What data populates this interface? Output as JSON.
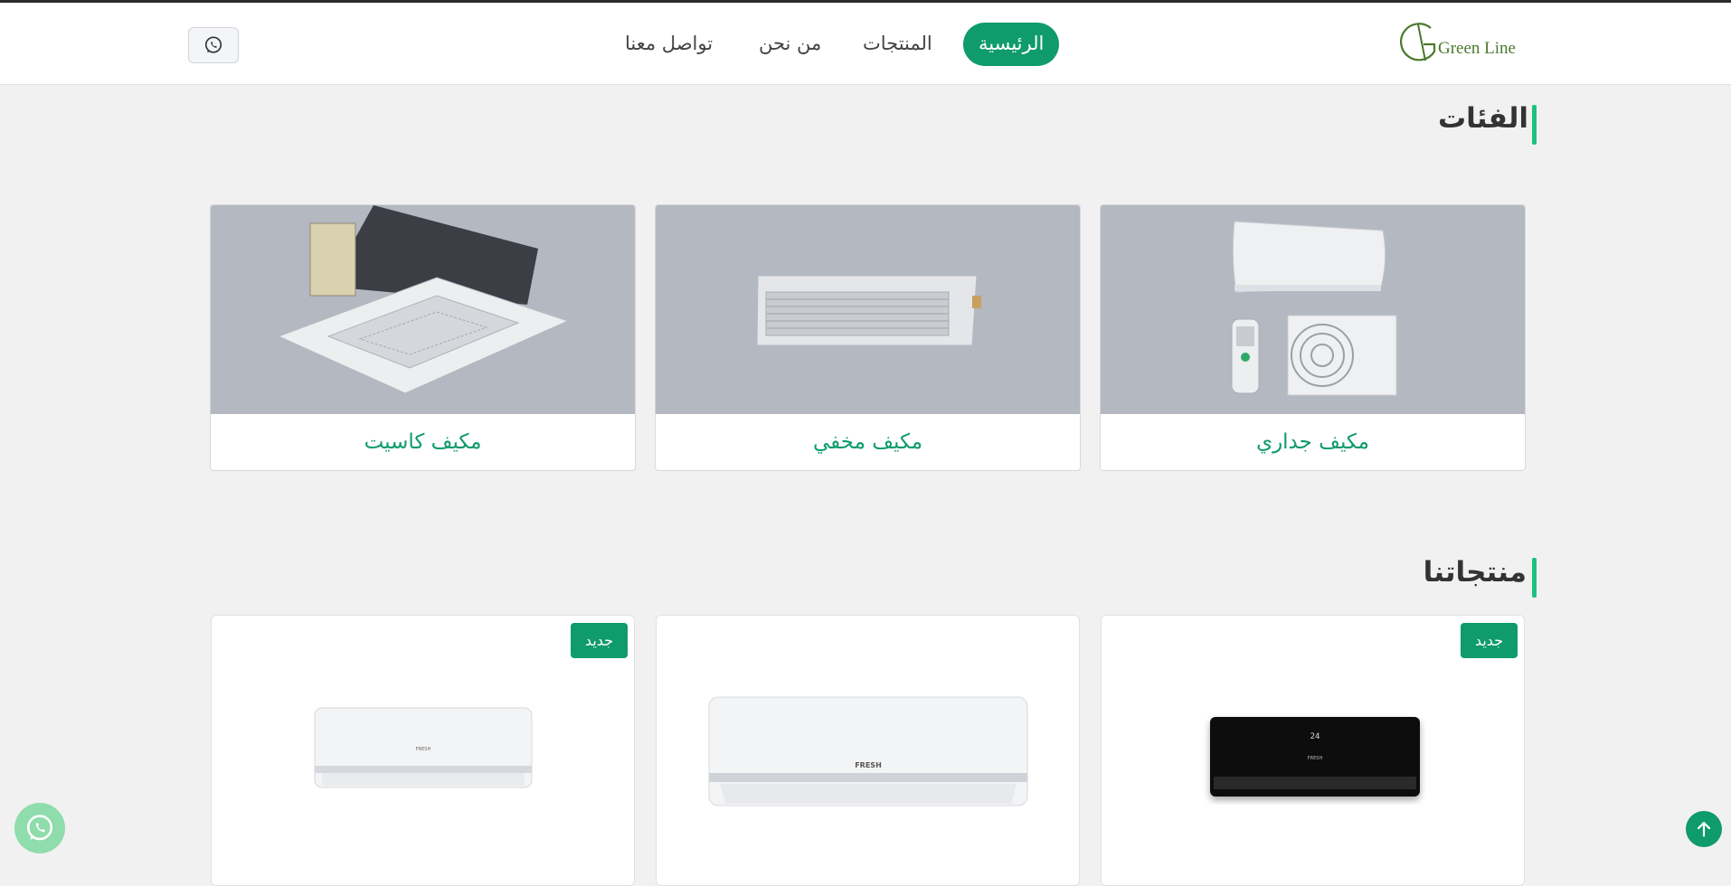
{
  "brand": {
    "name": "Green Line",
    "accent": "#0f9b6b",
    "title_bar_color": "#1fbf80"
  },
  "nav": {
    "items": [
      {
        "label": "الرئيسية",
        "active": true
      },
      {
        "label": "المنتجات",
        "active": false
      },
      {
        "label": "من نحن",
        "active": false
      },
      {
        "label": "تواصل معنا",
        "active": false
      }
    ]
  },
  "header": {
    "whatsapp_icon": "whatsapp-icon"
  },
  "categories": {
    "title": "الفئات",
    "items": [
      {
        "label": "مكيف جداري",
        "image": "wall-split-ac"
      },
      {
        "label": "مكيف مخفي",
        "image": "ducted-ac"
      },
      {
        "label": "مكيف كاسيت",
        "image": "cassette-ac"
      }
    ]
  },
  "products": {
    "title": "منتجاتنا",
    "items": [
      {
        "badge": "جديد",
        "image": "black-wall-ac",
        "display_text": "24",
        "brand_text": "FRESH"
      },
      {
        "badge": "",
        "image": "white-wall-ac-large",
        "brand_text": "FRESH"
      },
      {
        "badge": "جديد",
        "image": "white-wall-ac-small",
        "brand_text": "FRESH"
      }
    ]
  },
  "floating": {
    "whatsapp_icon": "whatsapp-icon",
    "back_to_top_icon": "arrow-up-icon"
  }
}
